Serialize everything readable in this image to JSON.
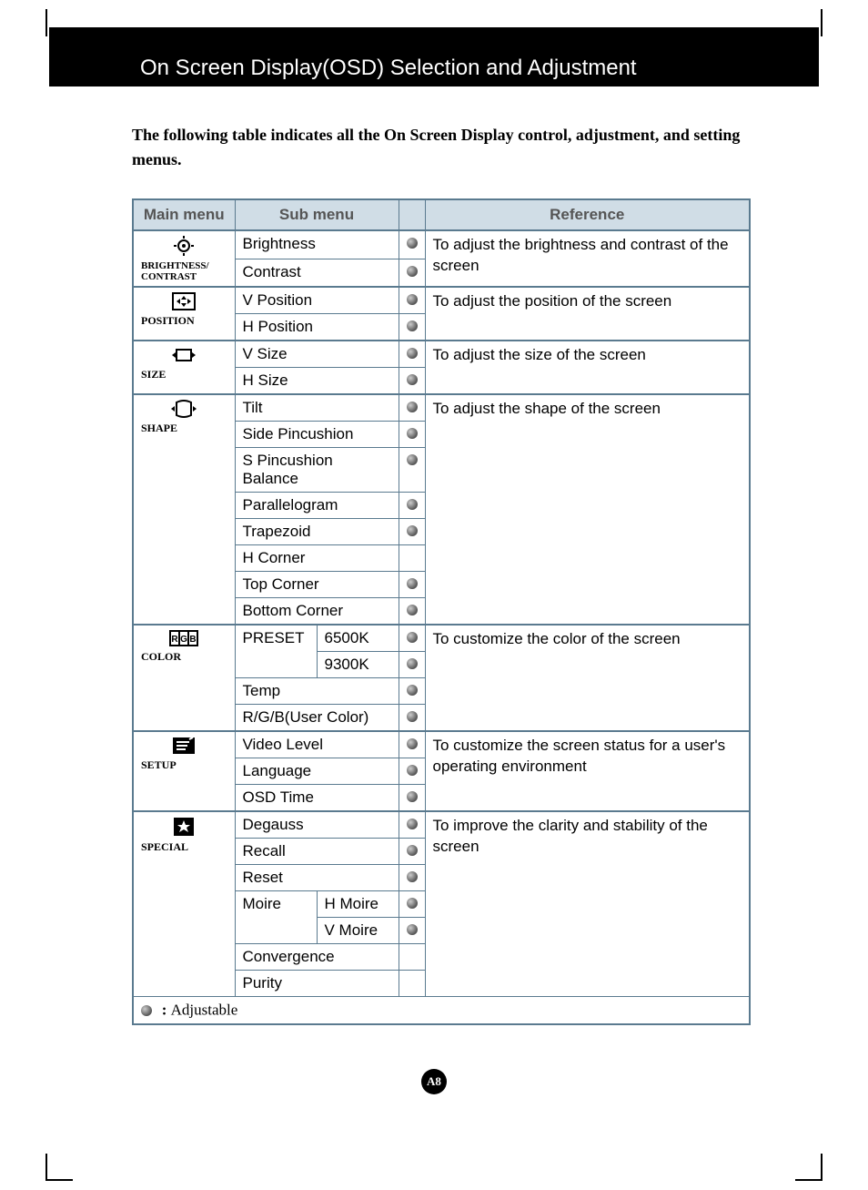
{
  "header": {
    "title": "On Screen Display(OSD) Selection and Adjustment"
  },
  "intro": "The following table indicates all the On Screen Display control, adjustment, and setting menus.",
  "columns": {
    "main": "Main menu",
    "sub": "Sub menu",
    "ref": "Reference"
  },
  "sections": {
    "brightness": {
      "label_line1": "BRIGHTNESS/",
      "label_line2": "CONTRAST",
      "reference": "To adjust the brightness and contrast of the screen",
      "items": [
        "Brightness",
        "Contrast"
      ]
    },
    "position": {
      "label": "POSITION",
      "reference": "To adjust the position of the screen",
      "items": [
        "V Position",
        "H Position"
      ]
    },
    "size": {
      "label": "SIZE",
      "reference": "To adjust the size of the screen",
      "items": [
        "V Size",
        "H Size"
      ]
    },
    "shape": {
      "label": "SHAPE",
      "reference": "To adjust the shape of the screen",
      "items": [
        "Tilt",
        "Side Pincushion",
        "S Pincushion Balance",
        "Parallelogram",
        "Trapezoid",
        "H Corner",
        "Top Corner",
        "Bottom Corner"
      ]
    },
    "color": {
      "label": "COLOR",
      "reference": "To customize the color of the screen",
      "preset_label": "PRESET",
      "preset_options": [
        "6500K",
        "9300K"
      ],
      "items": [
        "Temp",
        "R/G/B(User Color)"
      ]
    },
    "setup": {
      "label": "SETUP",
      "reference": "To customize the screen status for a user's operating environment",
      "items": [
        "Video Level",
        "Language",
        "OSD Time"
      ]
    },
    "special": {
      "label": "SPECIAL",
      "reference": "To improve the clarity and stability of the screen",
      "items": [
        "Degauss",
        "Recall",
        "Reset"
      ],
      "moire_label": "Moire",
      "moire_options": [
        "H Moire",
        "V Moire"
      ],
      "tail_items": [
        "Convergence",
        "Purity"
      ]
    }
  },
  "legend": {
    "text": "Adjustable",
    "prefix": ": "
  },
  "page_number": "A8"
}
